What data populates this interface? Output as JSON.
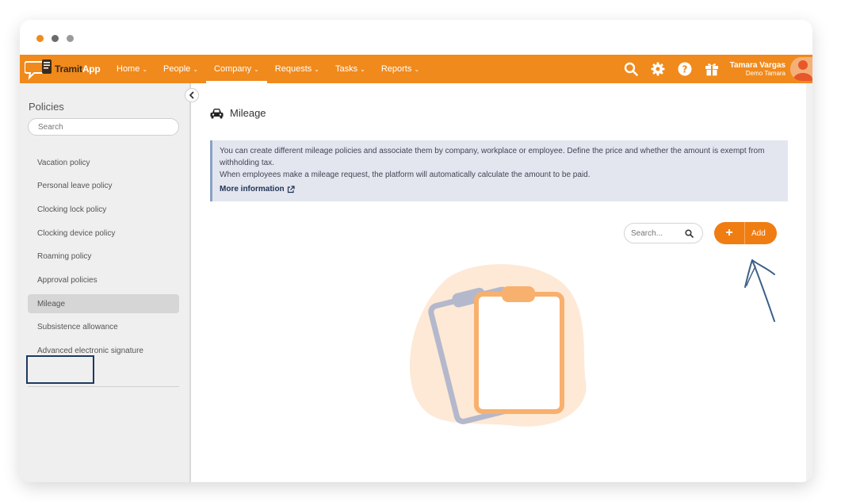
{
  "app": {
    "logo_text_1": "Tramit",
    "logo_text_2": "App"
  },
  "nav": {
    "items": [
      {
        "label": "Home",
        "active": false
      },
      {
        "label": "People",
        "active": false
      },
      {
        "label": "Company",
        "active": true
      },
      {
        "label": "Requests",
        "active": false
      },
      {
        "label": "Tasks",
        "active": false
      },
      {
        "label": "Reports",
        "active": false
      }
    ],
    "user_name": "Tamara Vargas",
    "user_company": "Demo Tamara"
  },
  "sidebar": {
    "title": "Policies",
    "search_placeholder": "Search",
    "items": [
      {
        "label": "Vacation policy"
      },
      {
        "label": "Personal leave policy"
      },
      {
        "label": "Clocking lock policy"
      },
      {
        "label": "Clocking device policy"
      },
      {
        "label": "Roaming policy"
      },
      {
        "label": "Approval policies"
      },
      {
        "label": "Mileage"
      },
      {
        "label": "Subsistence allowance"
      },
      {
        "label": "Advanced electronic signature"
      }
    ],
    "active_index": 6
  },
  "main": {
    "title": "Mileage",
    "info_line_1": "You can create different mileage policies and associate them by company, workplace or employee. Define the price and whether the amount is exempt from withholding tax.",
    "info_line_2": "When employees make a mileage request, the platform will automatically calculate the amount to be paid.",
    "info_link": "More information",
    "search_placeholder": "Search...",
    "add_label": "Add"
  },
  "colors": {
    "brand_orange": "#f08a1c",
    "add_button": "#f07d12",
    "info_bg": "#e3e6ef",
    "annotation": "#3d6088"
  }
}
